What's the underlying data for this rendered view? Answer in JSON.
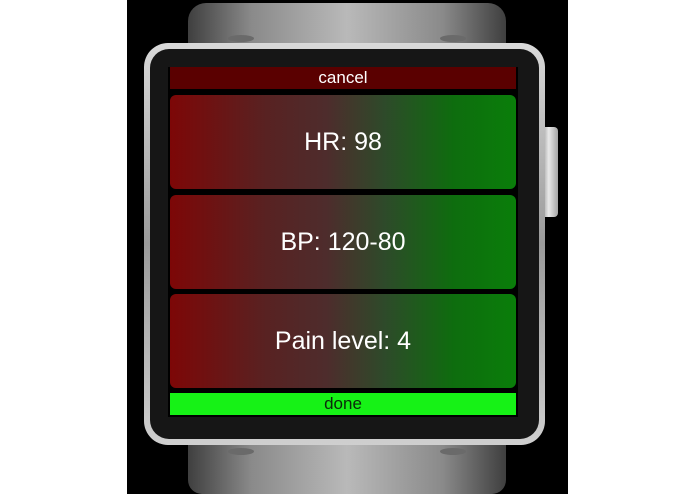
{
  "screen": {
    "cancel_label": "cancel",
    "done_label": "done",
    "items": [
      {
        "label": "HR: 98"
      },
      {
        "label": "BP: 120-80"
      },
      {
        "label": "Pain level: 4"
      }
    ]
  },
  "colors": {
    "cancel_bg": "#5a0000",
    "done_bg": "#16f216",
    "gradient_left": "#7d0707",
    "gradient_right": "#0a7e0a"
  }
}
